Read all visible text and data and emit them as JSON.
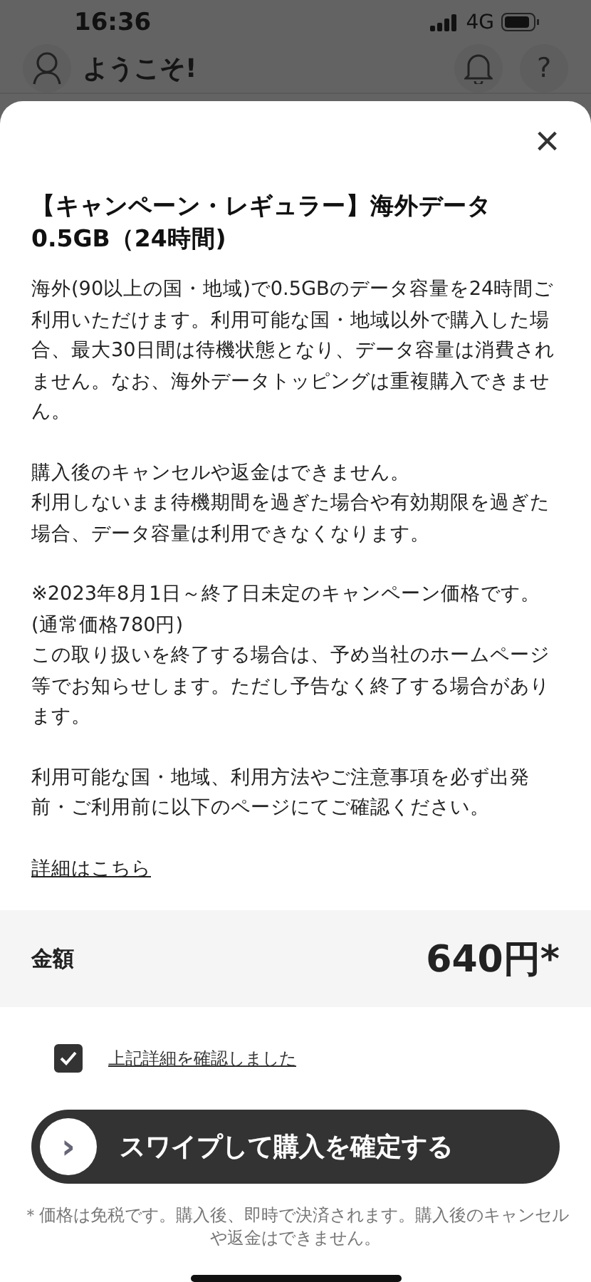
{
  "status_bar": {
    "time": "16:36",
    "network": "4G"
  },
  "header": {
    "title": "ようこそ!",
    "help": "?"
  },
  "sheet": {
    "close": "×",
    "title": "【キャンペーン・レギュラー】海外データ0.5GB（24時間)",
    "paragraphs": [
      [
        "海外(90以上の国・地域)で0.5GBのデータ容量を24時間ご利用いただけます。利用可能な国・地域以外で購入した場合、最大30日間は待機状態となり、データ容量は消費されません。なお、海外データトッピングは重複購入できません。"
      ],
      [
        "購入後のキャンセルや返金はできません。",
        "利用しないまま待機期間を過ぎた場合や有効期限を過ぎた場合、データ容量は利用できなくなります。"
      ],
      [
        "※2023年8月1日～終了日未定のキャンペーン価格です。",
        "(通常価格780円)",
        "この取り扱いを終了する場合は、予め当社のホームページ等でお知らせします。ただし予告なく終了する場合があります。"
      ],
      [
        "利用可能な国・地域、利用方法やご注意事項を必ず出発前・ご利用前に以下のページにてご確認ください。"
      ]
    ],
    "details_link": "詳細はこちら",
    "price": {
      "label": "金額",
      "value": "640円*"
    },
    "agreement": {
      "label": "上記詳細を確認しました",
      "checked": true
    },
    "swipe": {
      "label": "スワイプして購入を確定する",
      "knob": "›",
      "level": 0
    },
    "note": "＊価格は免税です。購入後、即時で決済されます。購入後のキャンセルや返金はできません。"
  }
}
